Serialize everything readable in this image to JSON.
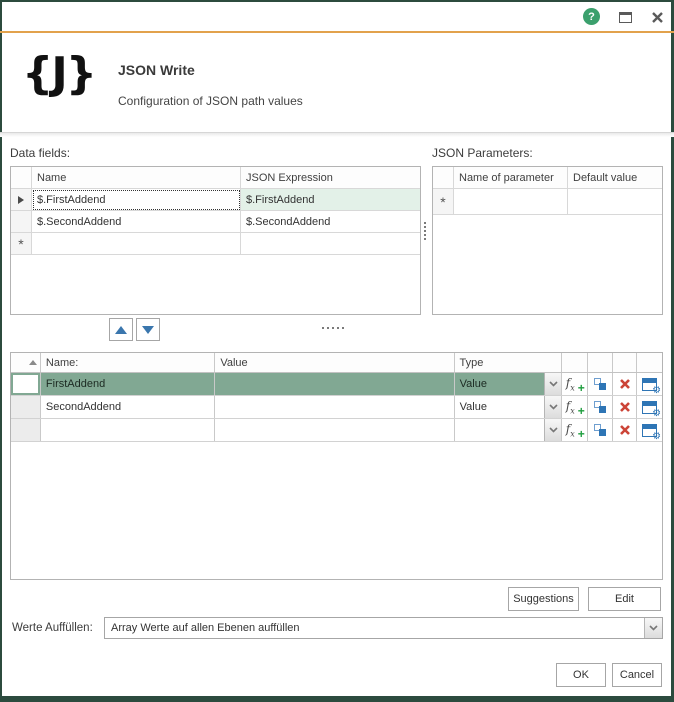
{
  "titlebar": {
    "help_label": "?"
  },
  "header": {
    "icon_text": "{J}",
    "title": "JSON Write",
    "subtitle": "Configuration of JSON path values"
  },
  "data_fields": {
    "label": "Data fields:",
    "columns": {
      "name": "Name",
      "expression": "JSON Expression"
    },
    "rows": [
      {
        "name": "$.FirstAddend",
        "expression": "$.FirstAddend"
      },
      {
        "name": "$.SecondAddend",
        "expression": "$.SecondAddend"
      },
      {
        "name": "",
        "expression": ""
      }
    ],
    "new_row_marker": "*"
  },
  "json_parameters": {
    "label": "JSON Parameters:",
    "columns": {
      "name": "Name of parameter",
      "default": "Default value"
    },
    "rows": [
      {
        "name": "",
        "default": ""
      }
    ],
    "new_row_marker": "*"
  },
  "values_grid": {
    "columns": {
      "name": "Name:",
      "value": "Value",
      "type": "Type"
    },
    "rows": [
      {
        "name": "FirstAddend",
        "value": "",
        "type": "Value"
      },
      {
        "name": "SecondAddend",
        "value": "",
        "type": "Value"
      },
      {
        "name": "",
        "value": "",
        "type": ""
      }
    ]
  },
  "buttons": {
    "suggestions": "Suggestions",
    "edit": "Edit",
    "ok": "OK",
    "cancel": "Cancel"
  },
  "fill_values": {
    "label": "Werte Auffüllen:",
    "value": "Array Werte auf allen Ebenen auffüllen"
  },
  "colors": {
    "window_border": "#2c4b3e",
    "accent_line": "#e2a24c",
    "help_icon": "#3ba06d",
    "selected_row": "#81a893",
    "selected_cell": "#e3f1e8",
    "icon_blue": "#2e75b5",
    "icon_green": "#1e9e3e",
    "icon_red": "#cc4437"
  }
}
